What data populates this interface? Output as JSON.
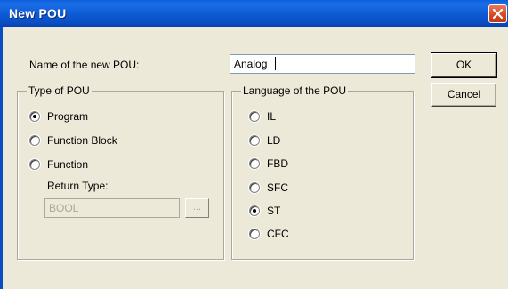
{
  "window": {
    "title": "New POU",
    "close_icon": "close-icon"
  },
  "name_field": {
    "label": "Name of the new POU:",
    "value": "Analog"
  },
  "buttons": {
    "ok": "OK",
    "cancel": "Cancel",
    "browse": "..."
  },
  "type_group": {
    "legend": "Type of POU",
    "options": [
      {
        "label": "Program",
        "selected": true
      },
      {
        "label": "Function Block",
        "selected": false
      },
      {
        "label": "Function",
        "selected": false
      }
    ],
    "return_type_label": "Return Type:",
    "return_type_value": "BOOL"
  },
  "language_group": {
    "legend": "Language of the POU",
    "options": [
      {
        "label": "IL",
        "selected": false
      },
      {
        "label": "LD",
        "selected": false
      },
      {
        "label": "FBD",
        "selected": false
      },
      {
        "label": "SFC",
        "selected": false
      },
      {
        "label": "ST",
        "selected": true
      },
      {
        "label": "CFC",
        "selected": false
      }
    ]
  },
  "colors": {
    "titlebar": "#0a5fd8",
    "dialog_bg": "#ece9d8",
    "close_button": "#d6461f"
  }
}
